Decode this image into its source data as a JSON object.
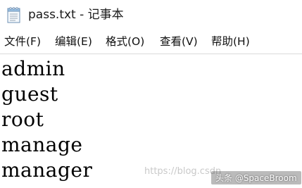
{
  "window": {
    "title": "pass.txt - 记事本",
    "icon": "notepad-icon"
  },
  "menubar": {
    "items": [
      {
        "label": "文件(F)"
      },
      {
        "label": "编辑(E)"
      },
      {
        "label": "格式(O)"
      },
      {
        "label": "查看(V)"
      },
      {
        "label": "帮助(H)"
      }
    ]
  },
  "editor": {
    "lines": [
      "admin",
      "guest",
      "root",
      "manage",
      "manager"
    ]
  },
  "watermark": {
    "url": "https://blog.csdn",
    "author": "头条 @SpaceBroom"
  }
}
